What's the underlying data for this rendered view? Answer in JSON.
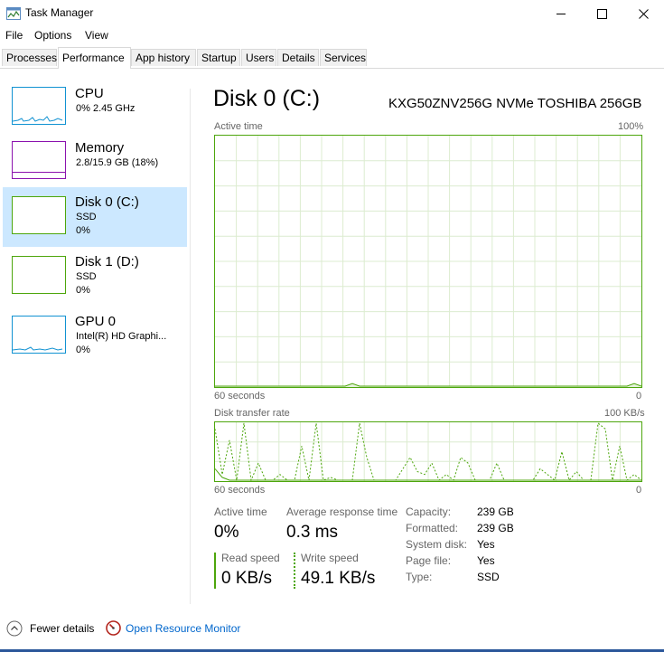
{
  "window": {
    "title": "Task Manager"
  },
  "menu": [
    "File",
    "Options",
    "View"
  ],
  "tabs": [
    "Processes",
    "Performance",
    "App history",
    "Startup",
    "Users",
    "Details",
    "Services"
  ],
  "sidebar": {
    "items": [
      {
        "name": "CPU",
        "line1": "0%  2.45 GHz",
        "line2": ""
      },
      {
        "name": "Memory",
        "line1": "2.8/15.9 GB (18%)",
        "line2": ""
      },
      {
        "name": "Disk 0 (C:)",
        "line1": "SSD",
        "line2": "0%"
      },
      {
        "name": "Disk 1 (D:)",
        "line1": "SSD",
        "line2": "0%"
      },
      {
        "name": "GPU 0",
        "line1": "Intel(R) HD Graphi...",
        "line2": "0%"
      }
    ]
  },
  "main": {
    "title": "Disk 0 (C:)",
    "model": "KXG50ZNV256G NVMe TOSHIBA 256GB",
    "active_graph": {
      "label": "Active time",
      "max": "100%",
      "time_label": "60 seconds",
      "min": "0"
    },
    "transfer_graph": {
      "label": "Disk transfer rate",
      "max": "100 KB/s",
      "time_label": "60 seconds",
      "min": "0"
    },
    "stats": {
      "active_time_label": "Active time",
      "active_time_value": "0%",
      "avg_response_label": "Average response time",
      "avg_response_value": "0.3 ms",
      "read_label": "Read speed",
      "read_value": "0 KB/s",
      "write_label": "Write speed",
      "write_value": "49.1 KB/s"
    },
    "properties": [
      {
        "label": "Capacity:",
        "value": "239 GB"
      },
      {
        "label": "Formatted:",
        "value": "239 GB"
      },
      {
        "label": "System disk:",
        "value": "Yes"
      },
      {
        "label": "Page file:",
        "value": "Yes"
      },
      {
        "label": "Type:",
        "value": "SSD"
      }
    ]
  },
  "footer": {
    "fewer_details": "Fewer details",
    "resource_monitor": "Open Resource Monitor"
  },
  "colors": {
    "disk_green": "#4da60c",
    "cpu_blue": "#1192d2",
    "memory_purple": "#8b12ae",
    "selection": "#cce8ff",
    "link": "#0066cc"
  },
  "series": {
    "active_time": [
      0,
      0,
      0,
      0,
      0,
      0,
      0,
      0,
      0,
      0,
      0,
      0,
      0,
      0,
      0,
      0,
      0,
      0,
      0,
      1,
      0,
      0,
      0,
      0,
      0,
      0,
      0,
      0,
      0,
      0,
      0,
      0,
      0,
      0,
      0,
      0,
      0,
      0,
      0,
      0,
      0,
      0,
      0,
      0,
      0,
      0,
      0,
      0,
      0,
      0,
      0,
      0,
      0,
      0,
      0,
      0,
      0,
      0,
      1,
      0
    ],
    "read": [
      20,
      5,
      0,
      0,
      0,
      0,
      0,
      0,
      0,
      0,
      0,
      0,
      0,
      0,
      0,
      0,
      0,
      0,
      0,
      0,
      0,
      0,
      0,
      0,
      0,
      0,
      0,
      0,
      0,
      0,
      0,
      0,
      0,
      0,
      0,
      0,
      0,
      0,
      0,
      0,
      0,
      0,
      0,
      0,
      0,
      0,
      0,
      0,
      0,
      0,
      0,
      0,
      0,
      0,
      0,
      0,
      0,
      0,
      0,
      0
    ],
    "write": [
      90,
      10,
      70,
      0,
      100,
      0,
      30,
      0,
      0,
      10,
      0,
      0,
      60,
      0,
      100,
      0,
      5,
      0,
      0,
      0,
      100,
      40,
      0,
      0,
      0,
      0,
      20,
      40,
      15,
      10,
      30,
      0,
      10,
      0,
      40,
      30,
      0,
      0,
      0,
      30,
      0,
      0,
      0,
      0,
      0,
      20,
      10,
      0,
      50,
      0,
      15,
      0,
      0,
      100,
      90,
      0,
      60,
      0,
      10,
      0
    ]
  }
}
